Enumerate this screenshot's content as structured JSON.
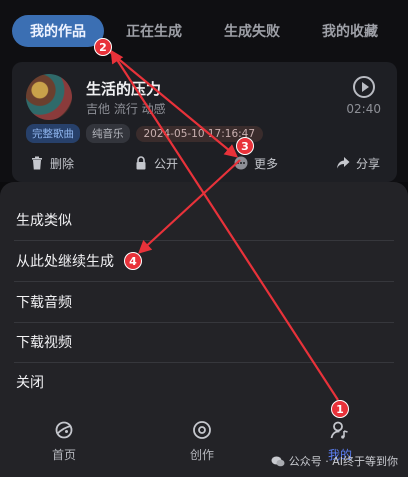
{
  "tabs": [
    {
      "label": "我的作品",
      "active": true
    },
    {
      "label": "正在生成",
      "active": false
    },
    {
      "label": "生成失败",
      "active": false
    },
    {
      "label": "我的收藏",
      "active": false
    }
  ],
  "song": {
    "title": "生活的压力",
    "tags": "吉他 流行 动感",
    "duration": "02:40",
    "badges": [
      "完整歌曲",
      "纯音乐"
    ],
    "created_at": "2024-05-10 17:16:47",
    "actions": {
      "delete": "删除",
      "public": "公开",
      "more": "更多",
      "share": "分享"
    }
  },
  "sheet": {
    "items": [
      "生成类似",
      "从此处继续生成",
      "下载音频",
      "下载视频",
      "关闭"
    ]
  },
  "bottom_nav": [
    {
      "label": "首页",
      "icon": "planet-icon",
      "active": false
    },
    {
      "label": "创作",
      "icon": "disc-icon",
      "active": false
    },
    {
      "label": "我的",
      "icon": "user-music-icon",
      "active": true
    }
  ],
  "annotations": [
    "1",
    "2",
    "3",
    "4"
  ],
  "watermark": "公众号 · AI终于等到你",
  "colors": {
    "accent": "#3b6fb3",
    "active_nav": "#5b7ff5",
    "annotation": "#e8323a",
    "background": "#0f0f12"
  }
}
